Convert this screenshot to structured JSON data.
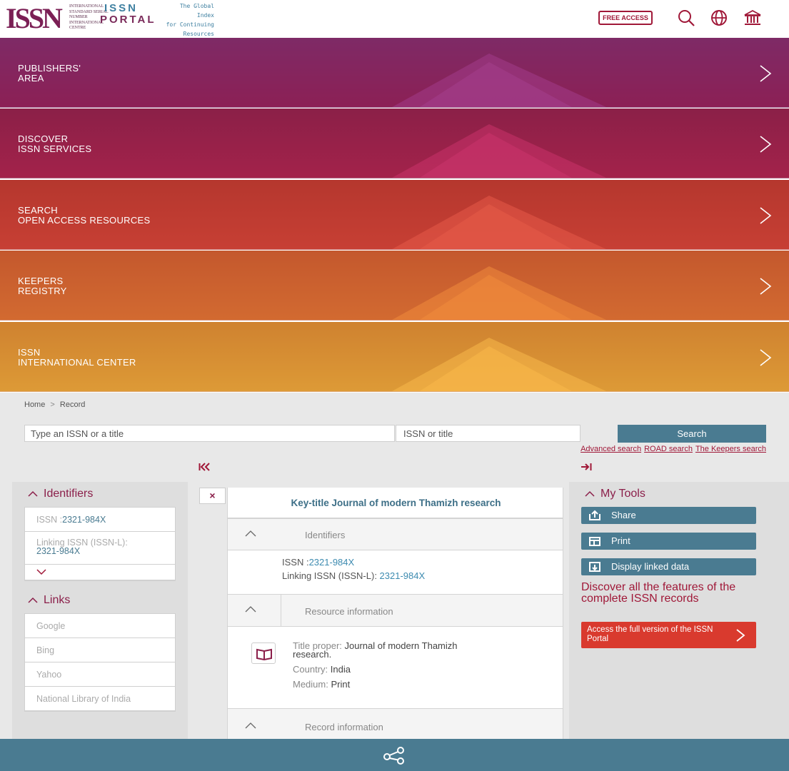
{
  "header": {
    "logo_text": "ISSN",
    "logo_small_lines": "INTERNATIONAL STANDARD SERIAL NUMBER INTERNATIONAL CENTRE",
    "portal_line1": "ISSN",
    "portal_line2": "PORTAL",
    "tagline_line1": "The Global Index",
    "tagline_line2": "for Continuing",
    "tagline_line3": "Resources",
    "free_access": "FREE ACCESS",
    "icons": [
      "search-icon",
      "globe-icon",
      "institution-icon"
    ]
  },
  "banners": [
    {
      "label": "PUBLISHERS'\nAREA",
      "color_top": "#7e2a66",
      "color_bottom": "#8c2055",
      "tri": "#a33d8a"
    },
    {
      "label": "DISCOVER\nISSN SERVICES",
      "color_top": "#8b2048",
      "color_bottom": "#a3224a",
      "tri": "#c8336a"
    },
    {
      "label": "SEARCH\nOPEN ACCESS RESOURCES",
      "color_top": "#b5372e",
      "color_bottom": "#c73f34",
      "tri": "#e55a48"
    },
    {
      "label": "KEEPERS\nREGISTRY",
      "color_top": "#c4582e",
      "color_bottom": "#d26a30",
      "tri": "#f08a3c"
    },
    {
      "label": "ISSN\nINTERNATIONAL CENTER",
      "color_top": "#cf8230",
      "color_bottom": "#dd9a36",
      "tri": "#f8b84a"
    }
  ],
  "breadcrumb": {
    "home": "Home",
    "separator": ">",
    "current": "Record"
  },
  "search": {
    "placeholder": "Type an ISSN or a title",
    "select_value": "ISSN or title",
    "button": "Search",
    "links": [
      "Advanced search",
      "ROAD search",
      "The Keepers search"
    ]
  },
  "nav": {
    "first": "|<<",
    "last": "->|"
  },
  "left": {
    "identifiers_title": "Identifiers",
    "issn_label": "ISSN :",
    "issn_value": "2321-984X",
    "linking_label": "Linking ISSN (ISSN-L):",
    "linking_value": "2321-984X",
    "links_title": "Links",
    "links": [
      "Google",
      "Bing",
      "Yahoo",
      "National Library of India"
    ]
  },
  "record": {
    "close": "×",
    "key_title": "Key-title Journal of modern Thamizh research",
    "identifiers_section": "Identifiers",
    "issn_label": "ISSN :",
    "issn_value": "2321-984X",
    "linking_label": "Linking ISSN (ISSN-L): ",
    "linking_value": "2321-984X",
    "resource_section": "Resource information",
    "title_label": "Title proper: ",
    "title_value": "Journal of modern Thamizh",
    "title_value2": "research.",
    "country_label": "Country: ",
    "country_value": "India",
    "medium_label": "Medium: ",
    "medium_value": "Print",
    "record_section": "Record information"
  },
  "tools": {
    "title": "My Tools",
    "share": "Share",
    "print": "Print",
    "linked_data": "Display linked data",
    "discover": "Discover all the features of the complete ISSN records",
    "full_version": "Access the full version of the ISSN Portal"
  },
  "colors": {
    "accent": "#8b1f4a",
    "teal": "#4a7b91",
    "orange_btn": "#d93a2e"
  }
}
